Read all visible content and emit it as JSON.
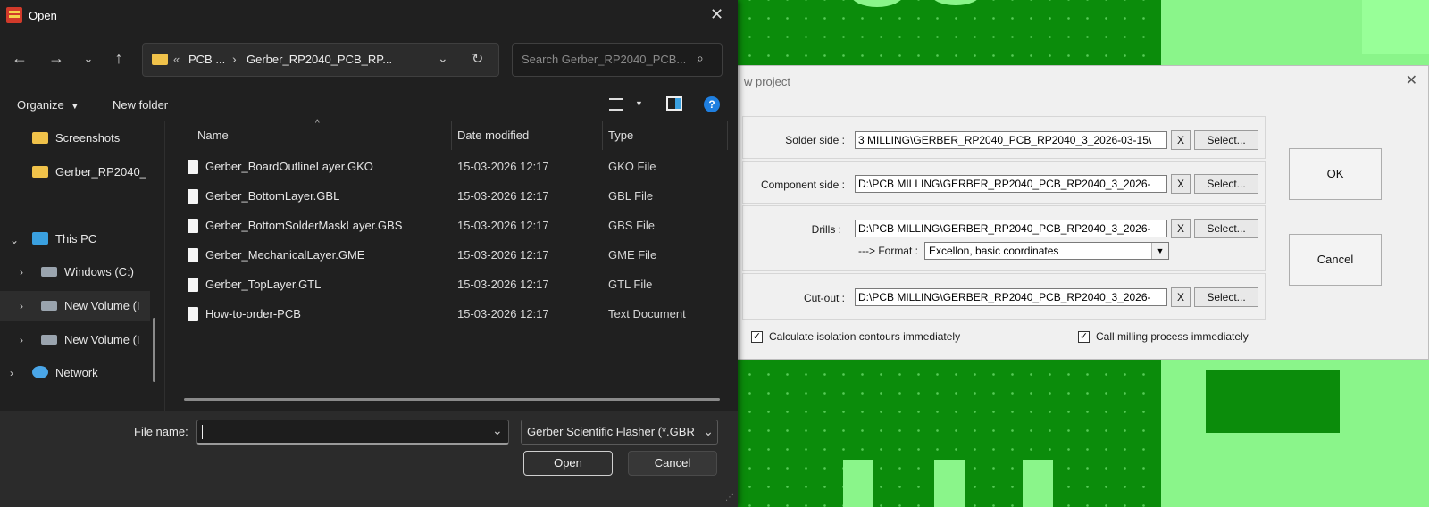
{
  "background": {
    "color": "#0b8c0b",
    "pad_color": "#8af58a"
  },
  "open_dialog": {
    "title": "Open",
    "address": {
      "prefix": "«",
      "segment1": "PCB ...",
      "separator": "›",
      "segment2": "Gerber_RP2040_PCB_RP..."
    },
    "search_placeholder": "Search Gerber_RP2040_PCB...",
    "toolbar": {
      "organize": "Organize",
      "new_folder": "New folder"
    },
    "nav": {
      "screenshots": "Screenshots",
      "gerber_folder": "Gerber_RP2040_",
      "this_pc": "This PC",
      "windows_c": "Windows (C:)",
      "new_volume_1": "New Volume (I",
      "new_volume_2": "New Volume (I",
      "network": "Network"
    },
    "columns": {
      "name": "Name",
      "date_modified": "Date modified",
      "type": "Type"
    },
    "files": [
      {
        "name": "Gerber_BoardOutlineLayer.GKO",
        "date": "15-03-2026 12:17",
        "type": "GKO File"
      },
      {
        "name": "Gerber_BottomLayer.GBL",
        "date": "15-03-2026 12:17",
        "type": "GBL File"
      },
      {
        "name": "Gerber_BottomSolderMaskLayer.GBS",
        "date": "15-03-2026 12:17",
        "type": "GBS File"
      },
      {
        "name": "Gerber_MechanicalLayer.GME",
        "date": "15-03-2026 12:17",
        "type": "GME File"
      },
      {
        "name": "Gerber_TopLayer.GTL",
        "date": "15-03-2026 12:17",
        "type": "GTL File"
      },
      {
        "name": "How-to-order-PCB",
        "date": "15-03-2026 12:17",
        "type": "Text Document"
      }
    ],
    "file_name_label": "File name:",
    "file_name_value": "",
    "file_type_value": "Gerber Scientific Flasher  (*.GBR",
    "open_label": "Open",
    "cancel_label": "Cancel"
  },
  "new_project": {
    "title": "w project",
    "solder_label": "Solder side :",
    "solder_path": "3 MILLING\\GERBER_RP2040_PCB_RP2040_3_2026-03-15\\",
    "component_label": "Component side :",
    "component_path": "D:\\PCB MILLING\\GERBER_RP2040_PCB_RP2040_3_2026-",
    "drills_label": "Drills :",
    "drills_path": "D:\\PCB MILLING\\GERBER_RP2040_PCB_RP2040_3_2026-",
    "format_label": "---> Format :",
    "format_value": "Excellon, basic coordinates",
    "cutout_label": "Cut-out :",
    "cutout_path": "D:\\PCB MILLING\\GERBER_RP2040_PCB_RP2040_3_2026-",
    "x_label": "X",
    "select_label": "Select...",
    "ok_label": "OK",
    "cancel_label": "Cancel",
    "calc_isolation_label": "Calculate isolation contours immediately",
    "calc_isolation_checked": true,
    "call_milling_label": "Call milling process immediately",
    "call_milling_checked": true
  }
}
